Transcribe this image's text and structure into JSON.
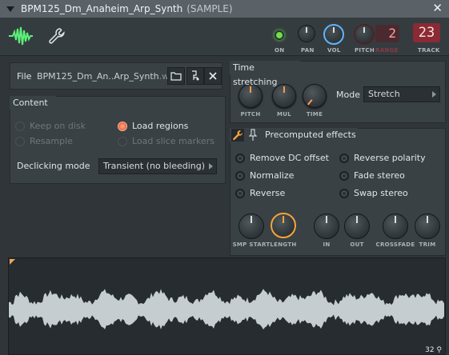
{
  "window": {
    "title": "BPM125_Dm_Anaheim_Arp_Synth",
    "suffix": "(SAMPLE)",
    "close_glyph": "✕"
  },
  "toolbar": {
    "on_label": "ON",
    "pan_label": "PAN",
    "vol_label": "VOL",
    "pitch_label": "PITCH",
    "range_label": "RANGE",
    "range_value": "2",
    "track_label": "TRACK",
    "track_value": "23",
    "icons": [
      "waveform-icon",
      "wrench-icon"
    ]
  },
  "file": {
    "label": "File",
    "name": "BPM125_Dm_An..Arp_Synth",
    "ext": ".wav",
    "buttons": [
      "folder-icon",
      "locate-icon",
      "close-icon"
    ]
  },
  "content": {
    "title": "Content",
    "options": [
      {
        "label": "Keep on disk",
        "checked": false,
        "enabled": false
      },
      {
        "label": "Load regions",
        "checked": true,
        "enabled": true
      },
      {
        "label": "Resample",
        "checked": false,
        "enabled": false
      },
      {
        "label": "Load slice markers",
        "checked": false,
        "enabled": false
      }
    ],
    "declicking_label": "Declicking mode",
    "declicking_value": "Transient (no bleeding)"
  },
  "time_stretching": {
    "title": "Time stretching",
    "knobs": [
      "PITCH",
      "MUL",
      "TIME"
    ],
    "mode_label": "Mode",
    "mode_value": "Stretch"
  },
  "precomputed": {
    "title": "Precomputed effects",
    "effects": [
      "Remove DC offset",
      "Reverse polarity",
      "Normalize",
      "Fade stereo",
      "Reverse",
      "Swap stereo"
    ],
    "knobs": [
      "SMP START",
      "LENGTH",
      "IN",
      "OUT",
      "CROSSFADE",
      "TRIM"
    ]
  },
  "waveform": {
    "end_label": "32",
    "accent": "#f2a25a",
    "wave_color": "#c6cdd0"
  },
  "colors": {
    "led": "#6fe04a",
    "vol_ring": "#5fb3ff",
    "length_ring": "#f5a43a",
    "radio_on": "#ff7a52",
    "track_bg": "#8a2a34"
  }
}
